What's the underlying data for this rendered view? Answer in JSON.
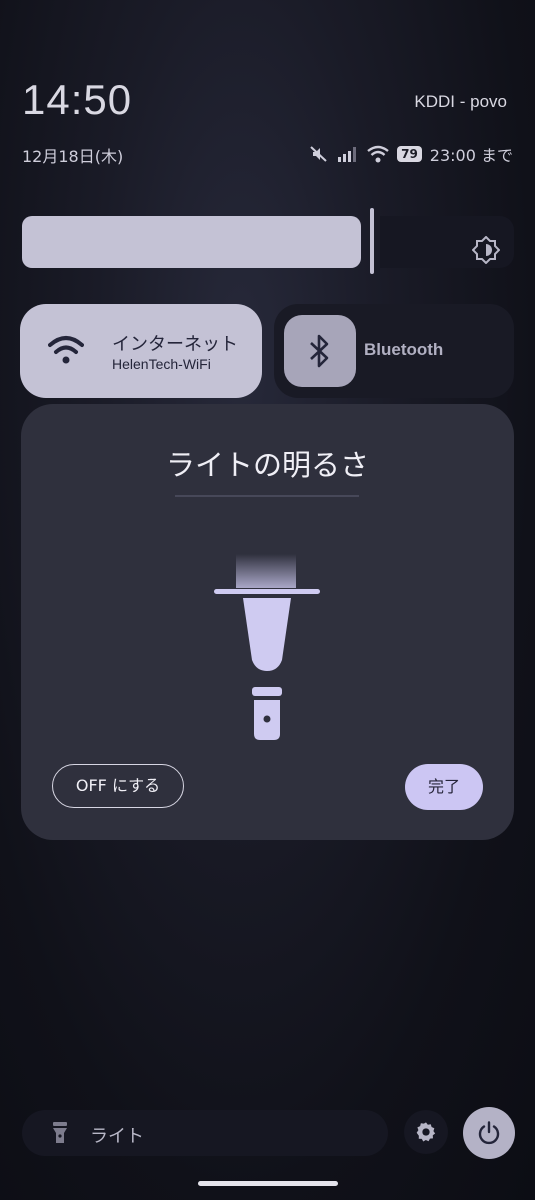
{
  "status": {
    "time": "14:50",
    "carrier": "KDDI - povo",
    "date": "12月18日(木)",
    "battery": "79",
    "alarm": "23:00 まで",
    "icons": [
      "mute-icon",
      "signal-icon",
      "wifi-icon",
      "battery-icon"
    ]
  },
  "brightness": {
    "level": 0.7,
    "icon": "brightness-icon"
  },
  "tiles": {
    "internet": {
      "title": "インターネット",
      "subtitle": "HelenTech-WiFi",
      "icon": "wifi-icon"
    },
    "bluetooth": {
      "label": "Bluetooth",
      "icon": "bluetooth-icon"
    }
  },
  "dialog": {
    "title": "ライトの明るさ",
    "off_label": "OFF にする",
    "done_label": "完了",
    "icon": "flashlight-icon"
  },
  "bottom": {
    "light_label": "ライト",
    "icons": [
      "flashlight-icon",
      "gear-icon",
      "power-icon"
    ]
  },
  "colors": {
    "accent": "#ccc6f3",
    "tile_active": "#c4c2d5",
    "dialog_bg": "#2f303d"
  }
}
